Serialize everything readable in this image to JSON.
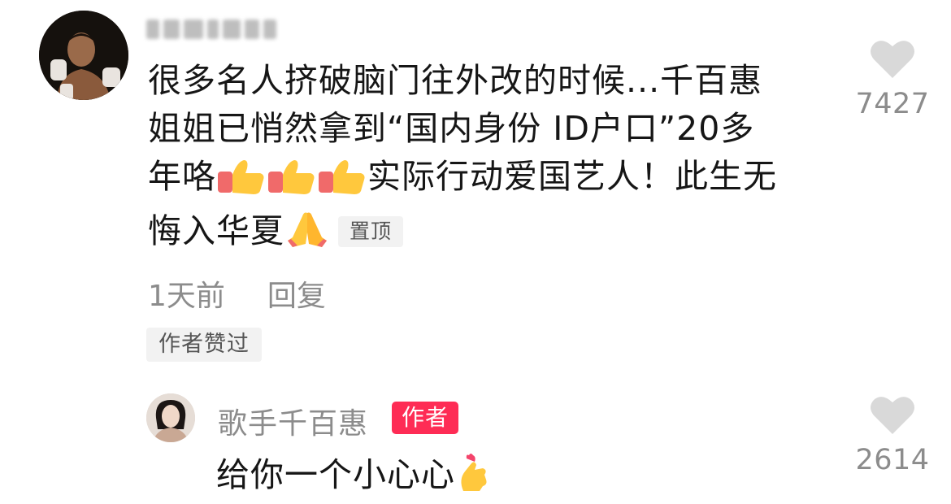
{
  "comment": {
    "text_line1": "很多名人挤破脑门往外改的时候...千百惠",
    "text_line2": "姐姐已悄然拿到“国内身份 ID户口”20多",
    "text_line3_before": "年咯",
    "text_line3_after": "实际行动爱国艺人！此生无",
    "text_line4": "悔入华夏",
    "pin_label": "置顶",
    "time": "1天前",
    "reply_label": "回复",
    "author_liked_label": "作者赞过",
    "like_count": "7427"
  },
  "reply": {
    "author_name": "歌手千百惠",
    "author_badge": "作者",
    "text": "给你一个小心心",
    "like_count": "2614"
  },
  "icons": {
    "heart": "heart-icon",
    "thumbs_up": "thumbs-up-emoji",
    "pray": "folded-hands-emoji",
    "finger_heart": "finger-heart-emoji"
  },
  "colors": {
    "text": "#161616",
    "meta": "#8c8c8c",
    "badge_bg": "#f2f2f2",
    "author_badge": "#fe2c55",
    "heart": "#d9d9d9"
  }
}
